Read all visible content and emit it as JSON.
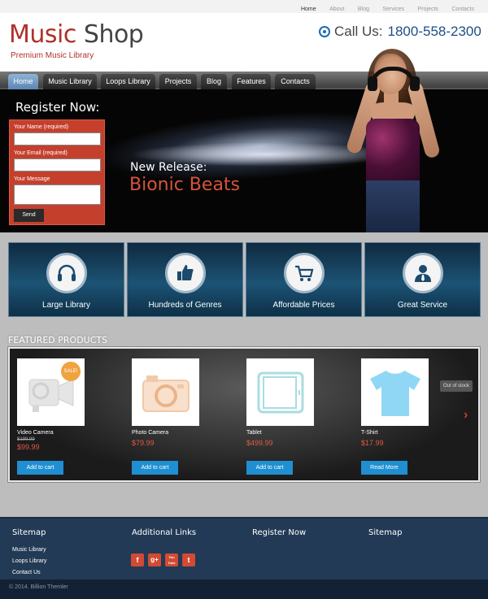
{
  "top_links": [
    "Home",
    "About",
    "Blog",
    "Services",
    "Projects",
    "Contacts"
  ],
  "logo": {
    "accent": "Music",
    "rest": " Shop",
    "tagline": "Premium Music Library"
  },
  "phone": {
    "label": "Call Us:",
    "number": "1800-558-2300"
  },
  "nav": [
    "Home",
    "Music Library",
    "Loops Library",
    "Projects",
    "Blog",
    "Features",
    "Contacts"
  ],
  "hero": {
    "register_title": "Register Now:",
    "form": {
      "name_label": "Your Name (required)",
      "email_label": "Your Email (required)",
      "message_label": "Your Message",
      "send": "Send"
    },
    "release_label": "New Release:",
    "release_name": "Bionic Beats"
  },
  "features": [
    {
      "label": "Large Library",
      "icon": "headphones-icon"
    },
    {
      "label": "Hundreds of Genres",
      "icon": "thumbs-up-icon"
    },
    {
      "label": "Affordable Prices",
      "icon": "cart-icon"
    },
    {
      "label": "Great Service",
      "icon": "person-icon"
    }
  ],
  "featured": {
    "title": "FEATURED PRODUCTS",
    "products": [
      {
        "name": "Video Camera",
        "old_price": "$199.99",
        "price": "$99.99",
        "button": "Add to cart",
        "badge": "SALE!",
        "icon": "video-camera-icon"
      },
      {
        "name": "Photo Camera",
        "price": "$79.99",
        "button": "Add to cart",
        "icon": "photo-camera-icon"
      },
      {
        "name": "Tablet",
        "price": "$499.99",
        "button": "Add to cart",
        "icon": "tablet-icon"
      },
      {
        "name": "T-Shirt",
        "price": "$17.99",
        "button": "Read More",
        "icon": "t-shirt-icon"
      }
    ],
    "out_of_stock": "Out of stock"
  },
  "footer": {
    "sitemap_title": "Sitemap",
    "sitemap_links": [
      "Music Library",
      "Loops Library",
      "Contact Us"
    ],
    "additional_title": "Additional Links",
    "register_title": "Register Now",
    "sitemap2_title": "Sitemap",
    "social": [
      "f",
      "g+",
      "You Tube",
      "t"
    ],
    "copyright": "© 2014. Billion Themler"
  },
  "colors": {
    "accent_red": "#b0312a",
    "phone_blue": "#1e4e86",
    "button_blue": "#1f8fd1",
    "footer_bg": "#233a56"
  }
}
